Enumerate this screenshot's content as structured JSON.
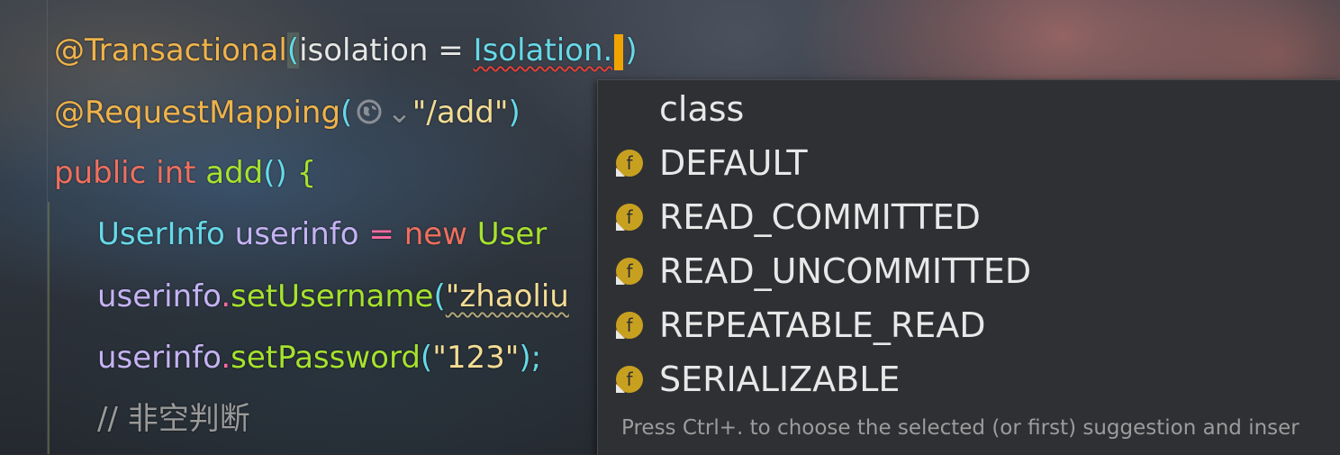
{
  "editor": {
    "lines": {
      "l1": {
        "annotation": "@Transactional",
        "paren_open": "(",
        "param": "isolation",
        "eq": " = ",
        "enum_ref": "Isolation.",
        "paren_close": ")"
      },
      "l2": {
        "annotation": "@RequestMapping",
        "paren_open": "(",
        "globe_chevron": "⌄",
        "string": "\"/add\"",
        "paren_close": ")"
      },
      "l3": {
        "public": "public",
        "int": " int ",
        "method": "add",
        "parens": "()",
        "brace": " {"
      },
      "l4": {
        "type": "UserInfo",
        "var": " userinfo",
        "eq": " = ",
        "new": "new",
        "type2": " User"
      },
      "l5": {
        "var": "userinfo",
        "dot": ".",
        "method": "setUsername",
        "paren": "(",
        "string": "\"zhaoliu"
      },
      "l6": {
        "var": "userinfo",
        "dot": ".",
        "method": "setPassword",
        "paren": "(",
        "string": "\"123\"",
        "close": ");"
      },
      "l7": {
        "comment": "// 非空判断"
      }
    }
  },
  "completion": {
    "items": [
      {
        "label": "class",
        "icon": null
      },
      {
        "label": "DEFAULT",
        "icon": "enum-constant-icon"
      },
      {
        "label": "READ_COMMITTED",
        "icon": "enum-constant-icon"
      },
      {
        "label": "READ_UNCOMMITTED",
        "icon": "enum-constant-icon"
      },
      {
        "label": "REPEATABLE_READ",
        "icon": "enum-constant-icon"
      },
      {
        "label": "SERIALIZABLE",
        "icon": "enum-constant-icon"
      }
    ],
    "hint": "Press Ctrl+. to choose the selected (or first) suggestion and inser",
    "icon_color": "#c8a020"
  }
}
